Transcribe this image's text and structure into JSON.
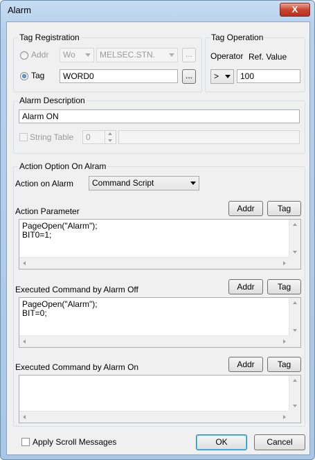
{
  "window": {
    "title": "Alarm",
    "close_glyph": "X"
  },
  "tag_registration": {
    "label": "Tag Registration",
    "addr_label": "Addr",
    "addr_combo1": "Wo",
    "addr_combo2": "MELSEC.STN.",
    "browse_label": "...",
    "tag_label": "Tag",
    "tag_value": "WORD0",
    "selected": "tag"
  },
  "tag_operation": {
    "label": "Tag Operation",
    "operator_label": "Operator",
    "refvalue_label": "Ref. Value",
    "operator_value": ">",
    "ref_value": "100"
  },
  "alarm_description": {
    "label": "Alarm Description",
    "value": "Alarm ON",
    "string_table_label": "String Table",
    "string_table_index": "0"
  },
  "action_option": {
    "label": "Action Option On Alram",
    "action_on_alarm_label": "Action on Alarm",
    "action_on_alarm_value": "Command Script",
    "addr_button": "Addr",
    "tag_button": "Tag",
    "action_parameter": {
      "label": "Action Parameter",
      "lines": "PageOpen(\"Alarm\");\nBIT0=1;"
    },
    "alarm_off": {
      "label": "Executed Command by Alarm Off",
      "lines": "PageOpen(\"Alarm\");\nBIT=0;"
    },
    "alarm_on": {
      "label": "Executed Command by Alarm On",
      "lines": ""
    }
  },
  "footer": {
    "apply_scroll_label": "Apply Scroll Messages",
    "ok_label": "OK",
    "cancel_label": "Cancel"
  }
}
